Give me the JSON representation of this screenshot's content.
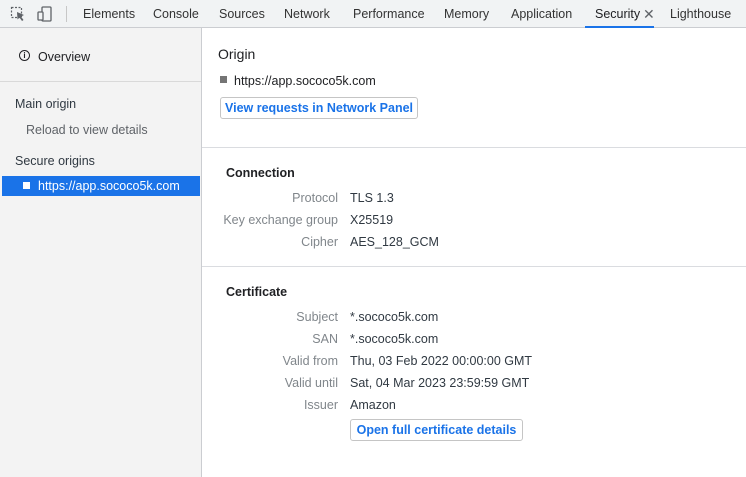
{
  "toolbar": {
    "inspect_icon": "inspect-element-icon",
    "device_icon": "device-toolbar-icon",
    "tabs": [
      "Elements",
      "Console",
      "Sources",
      "Network",
      "Performance",
      "Memory",
      "Application",
      "Security",
      "Lighthouse"
    ],
    "active_tab": "Security",
    "close_glyph": "✕"
  },
  "sidebar": {
    "overview_label": "Overview",
    "main_origin_heading": "Main origin",
    "main_origin_hint": "Reload to view details",
    "secure_origins_heading": "Secure origins",
    "selected_origin": "https://app.sococo5k.com"
  },
  "origin": {
    "title": "Origin",
    "url": "https://app.sococo5k.com",
    "view_requests_button": "View requests in Network Panel"
  },
  "connection": {
    "title": "Connection",
    "rows": [
      {
        "label": "Protocol",
        "value": "TLS 1.3"
      },
      {
        "label": "Key exchange group",
        "value": "X25519"
      },
      {
        "label": "Cipher",
        "value": "AES_128_GCM"
      }
    ]
  },
  "certificate": {
    "title": "Certificate",
    "rows": [
      {
        "label": "Subject",
        "value": "*.sococo5k.com"
      },
      {
        "label": "SAN",
        "value": "*.sococo5k.com"
      },
      {
        "label": "Valid from",
        "value": "Thu, 03 Feb 2022 00:00:00 GMT"
      },
      {
        "label": "Valid until",
        "value": "Sat, 04 Mar 2023 23:59:59 GMT"
      },
      {
        "label": "Issuer",
        "value": "Amazon"
      }
    ],
    "open_details_button": "Open full certificate details"
  },
  "colors": {
    "accent": "#1a73e8",
    "sidebar_bg": "#f3f3f3",
    "tabbar_bg": "#f1f3f4"
  }
}
